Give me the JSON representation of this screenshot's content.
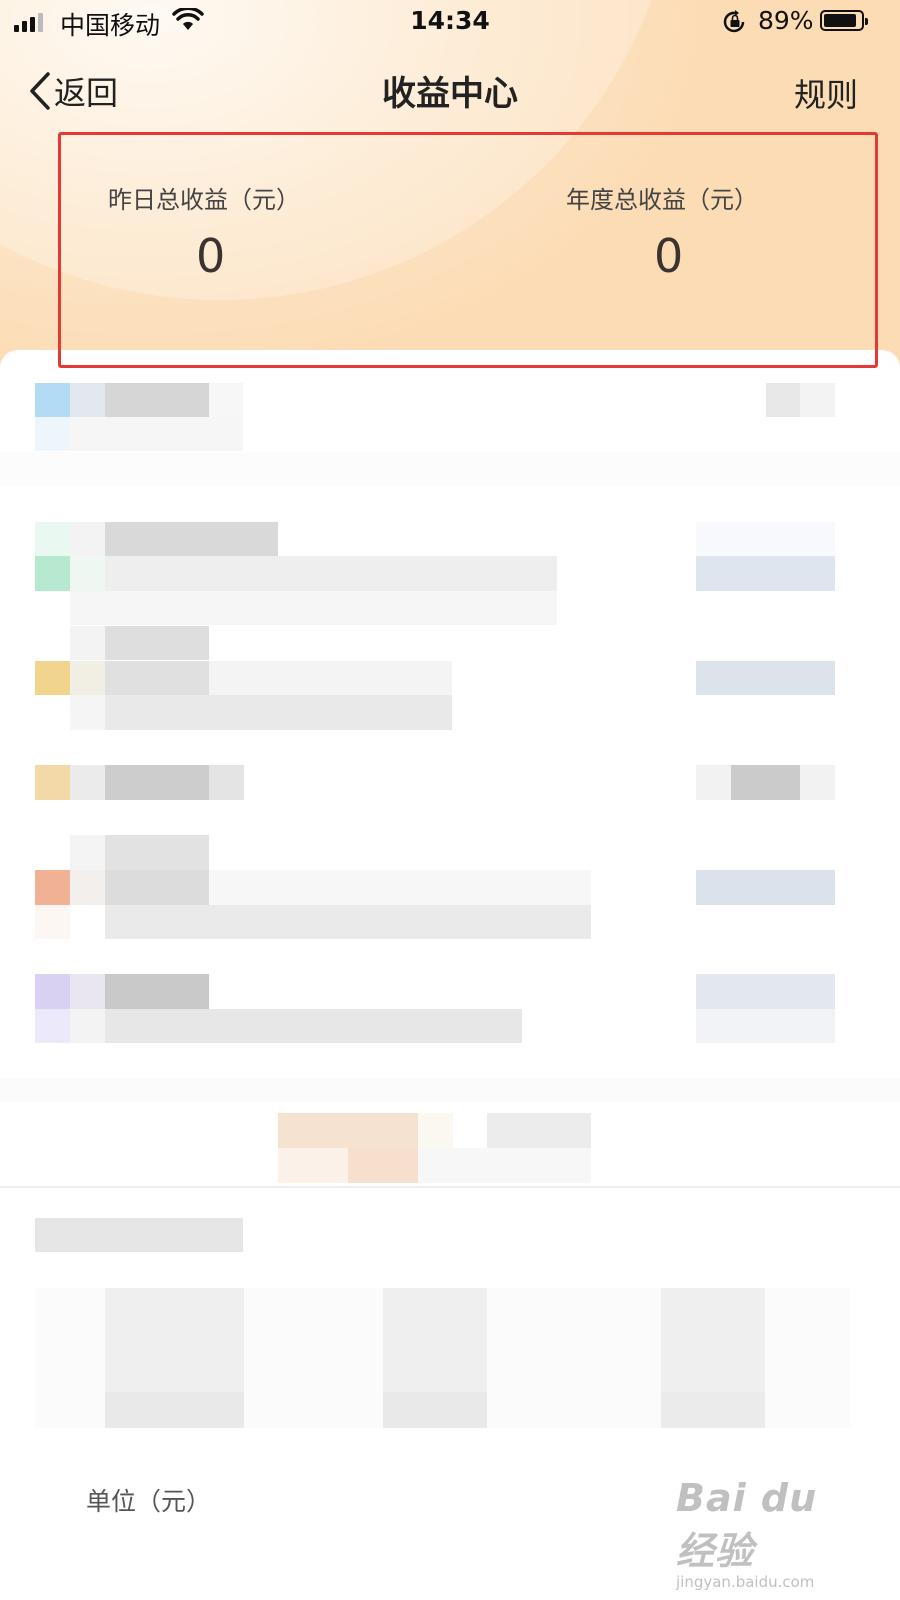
{
  "status_bar": {
    "carrier": "中国移动",
    "time": "14:34",
    "battery_percent": "89%",
    "battery_level": 0.89
  },
  "nav": {
    "back_label": "返回",
    "title": "收益中心",
    "rules_label": "规则"
  },
  "stats": {
    "yesterday": {
      "label": "昨日总收益（元）",
      "value": "0"
    },
    "year": {
      "label": "年度总收益（元）",
      "value": "0"
    }
  },
  "footer": {
    "unit_label": "单位（元）"
  },
  "watermark": {
    "brand": "Bai du 经验",
    "url": "jingyan.baidu.com"
  }
}
